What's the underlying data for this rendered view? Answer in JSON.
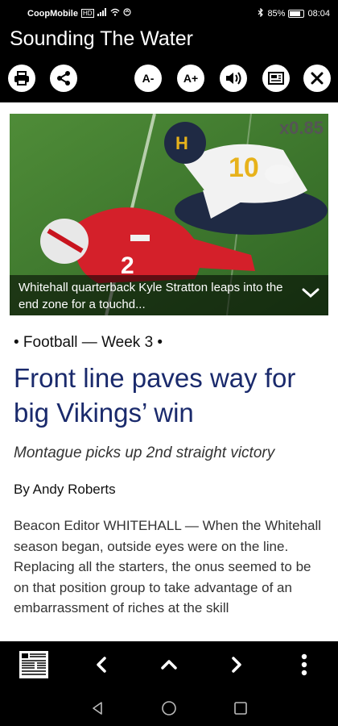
{
  "status": {
    "carrier": "CoopMobile",
    "carrier_badge": "HD",
    "battery": "85%",
    "time": "08:04"
  },
  "app": {
    "title": "Sounding The Water"
  },
  "toolbar": {
    "font_decrease": "A-",
    "font_increase": "A+"
  },
  "photo": {
    "zoom": "x0.85",
    "caption": "Whitehall quarterback Kyle Stratton leaps into the end zone for a touchd..."
  },
  "article": {
    "kicker": "• Football — Week 3 •",
    "headline": "Front line paves way for big Vikings’ win",
    "subhead": "Montague picks up 2nd straight victory",
    "byline": "By Andy Roberts",
    "body": "Beacon Editor WHITEHALL — When the Whitehall season began, outside eyes were on the line. Replacing all the starters, the onus seemed to be on that position group to take advantage of an embarrassment of riches at the skill"
  },
  "colors": {
    "headline": "#1a2a6c",
    "bar_background": "#000000"
  },
  "icons": [
    "print-icon",
    "share-icon",
    "speaker-icon",
    "reader-icon",
    "close-icon",
    "pages-grid-icon",
    "back-icon",
    "up-icon",
    "forward-icon",
    "more-icon"
  ]
}
